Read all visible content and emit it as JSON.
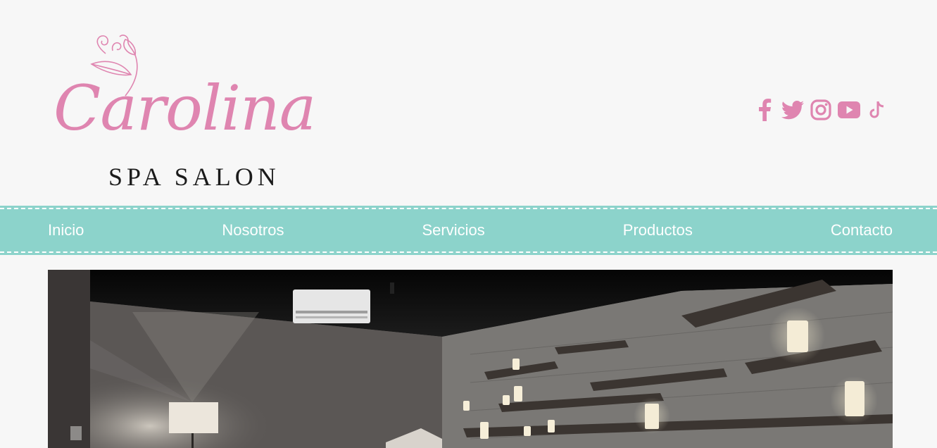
{
  "brand": {
    "script_name": "Carolina",
    "subtitle": "SPA SALON",
    "color": "#df85b0"
  },
  "social": [
    {
      "name": "facebook-icon"
    },
    {
      "name": "twitter-icon"
    },
    {
      "name": "instagram-icon"
    },
    {
      "name": "youtube-icon"
    },
    {
      "name": "tiktok-icon"
    }
  ],
  "nav": {
    "background": "#8cd3cb",
    "items": [
      {
        "label": "Inicio"
      },
      {
        "label": "Nosotros"
      },
      {
        "label": "Servicios"
      },
      {
        "label": "Productos"
      },
      {
        "label": "Contacto"
      }
    ]
  },
  "hero": {
    "subject": "spa-room-photo"
  }
}
